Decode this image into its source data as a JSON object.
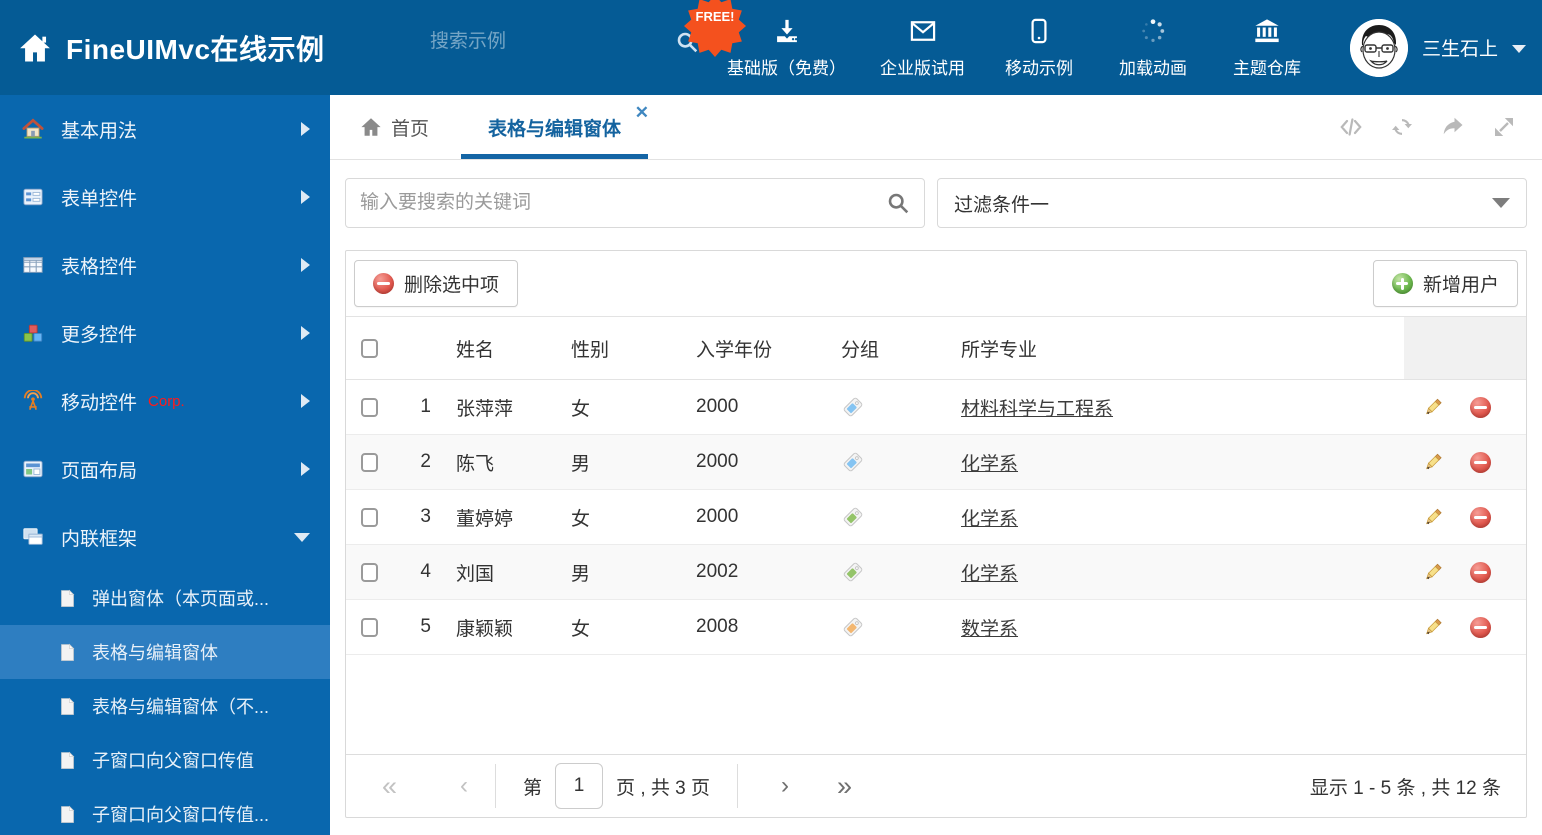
{
  "header": {
    "title": "FineUIMvc在线示例",
    "search_placeholder": "搜索示例",
    "free_badge": "FREE!",
    "nav_items": [
      {
        "label": "基础版（免费）",
        "icon": "download"
      },
      {
        "label": "企业版试用",
        "icon": "envelope"
      },
      {
        "label": "移动示例",
        "icon": "phone"
      },
      {
        "label": "加载动画",
        "icon": "spinner"
      },
      {
        "label": "主题仓库",
        "icon": "bank"
      }
    ],
    "username": "三生石上"
  },
  "sidebar": {
    "items": [
      {
        "label": "基本用法",
        "icon": "home-colored",
        "arrow": "arrow-right"
      },
      {
        "label": "表单控件",
        "icon": "form",
        "arrow": "arrow-right"
      },
      {
        "label": "表格控件",
        "icon": "table",
        "arrow": "arrow-right"
      },
      {
        "label": "更多控件",
        "icon": "cubes",
        "arrow": "arrow-right"
      },
      {
        "label": "移动控件",
        "badge": "Corp.",
        "icon": "antenna",
        "arrow": "arrow-right"
      },
      {
        "label": "页面布局",
        "icon": "layout",
        "arrow": "arrow-right"
      },
      {
        "label": "内联框架",
        "icon": "frames",
        "arrow": "arrow-down"
      }
    ],
    "subitems": [
      {
        "label": "弹出窗体（本页面或...",
        "icon": "file"
      },
      {
        "label": "表格与编辑窗体",
        "icon": "file",
        "selected": true
      },
      {
        "label": "表格与编辑窗体（不...",
        "icon": "file"
      },
      {
        "label": "子窗口向父窗口传值",
        "icon": "file"
      },
      {
        "label": "子窗口向父窗口传值...",
        "icon": "file"
      }
    ]
  },
  "tabbar": {
    "home_label": "首页",
    "active_label": "表格与编辑窗体"
  },
  "filters": {
    "search_placeholder": "输入要搜索的关键词",
    "filter_value": "过滤条件一"
  },
  "toolbar": {
    "delete_label": "删除选中项",
    "add_label": "新增用户"
  },
  "table": {
    "headers": [
      "姓名",
      "性别",
      "入学年份",
      "分组",
      "所学专业"
    ],
    "rows": [
      {
        "num": "1",
        "name": "张萍萍",
        "gender": "女",
        "year": "2000",
        "tag_color": "#85c4f2",
        "major": "材料科学与工程系"
      },
      {
        "num": "2",
        "name": "陈飞",
        "gender": "男",
        "year": "2000",
        "tag_color": "#85c4f2",
        "major": "化学系"
      },
      {
        "num": "3",
        "name": "董婷婷",
        "gender": "女",
        "year": "2000",
        "tag_color": "#94c469",
        "major": "化学系"
      },
      {
        "num": "4",
        "name": "刘国",
        "gender": "男",
        "year": "2002",
        "tag_color": "#94c469",
        "major": "化学系"
      },
      {
        "num": "5",
        "name": "康颖颖",
        "gender": "女",
        "year": "2008",
        "tag_color": "#f3b771",
        "major": "数学系"
      }
    ]
  },
  "pagination": {
    "first": "«",
    "prev": "‹",
    "next": "›",
    "last": "»",
    "page_prefix": "第",
    "page_value": "1",
    "page_suffix": "页 , 共 3 页",
    "summary": "显示 1 - 5 条 , 共 12 条"
  },
  "colors": {
    "header_bg": "#055b95",
    "sidebar_bg": "#0967ae",
    "sidebar_selected": "#2e7ec1",
    "active_tab": "#1465a5",
    "free_badge": "#f4511e",
    "delete_red": "#e25a50",
    "add_green": "#6db84e"
  }
}
